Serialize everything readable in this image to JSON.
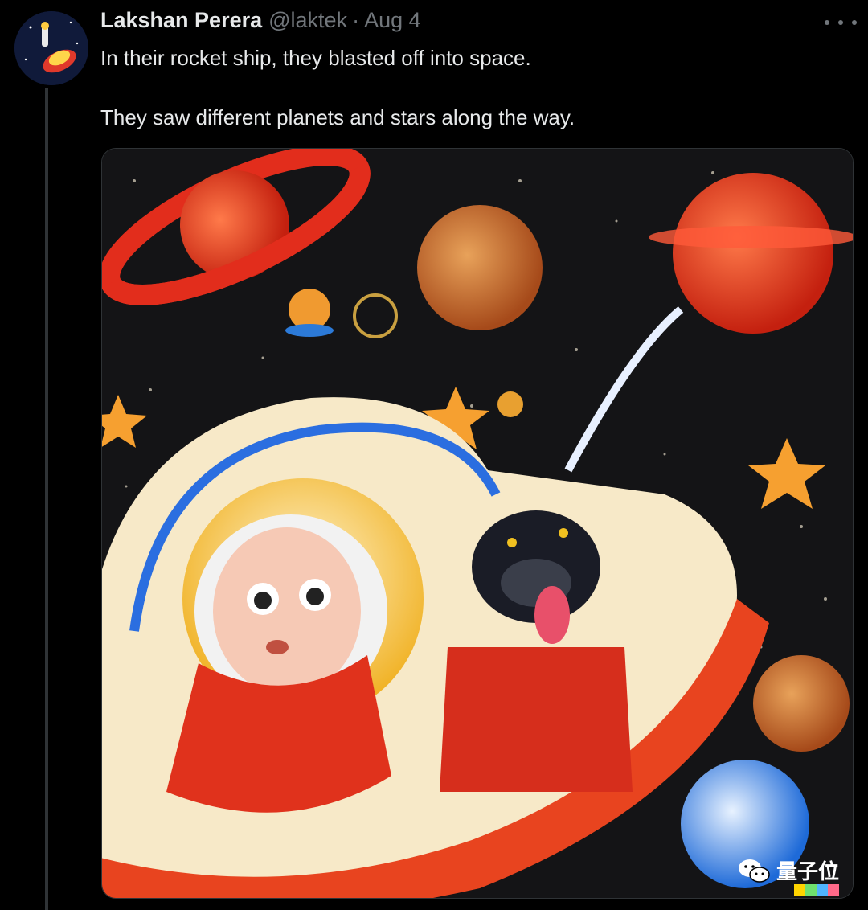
{
  "tweet": {
    "author_name": "Lakshan Perera",
    "handle": "@laktek",
    "separator": "·",
    "date": "Aug 4",
    "more_icon": "more-horizontal-icon",
    "text_lines": [
      "In their rocket ship, they blasted off into space.",
      "They saw different planets and stars along the way."
    ]
  },
  "media": {
    "type": "illustration",
    "subject_icons": [
      "planet-icon",
      "star-icon",
      "astronaut-icon",
      "dog-icon",
      "rocket-ship-icon"
    ]
  },
  "watermark": {
    "text": "量子位",
    "icon": "wechat-icon"
  },
  "colors": {
    "background": "#000000",
    "text_primary": "#e7e9ea",
    "text_secondary": "#71767b",
    "space": "#141416"
  }
}
